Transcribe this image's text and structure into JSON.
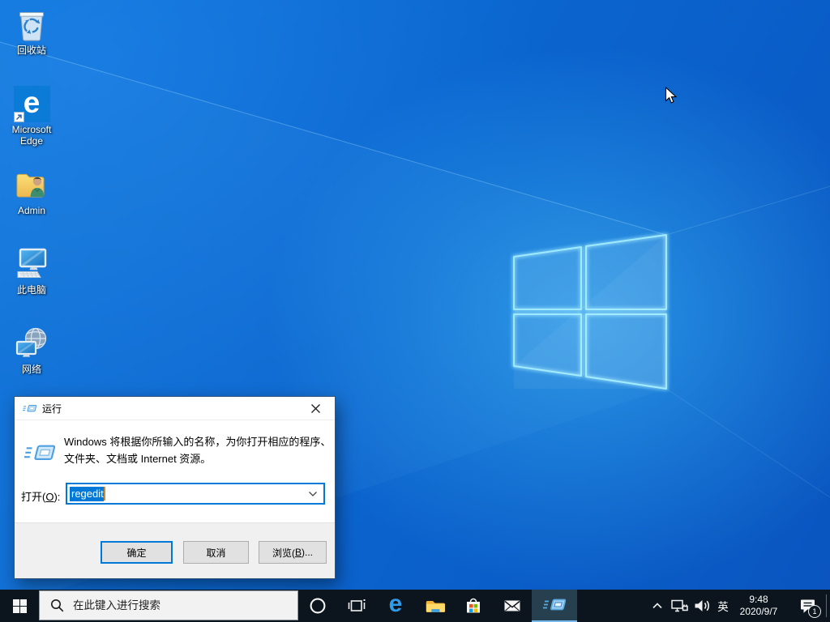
{
  "desktop": {
    "icons": [
      {
        "label": "回收站"
      },
      {
        "label": "Microsoft Edge"
      },
      {
        "label": "Admin"
      },
      {
        "label": "此电脑"
      },
      {
        "label": "网络"
      }
    ]
  },
  "run_dialog": {
    "title": "运行",
    "description_line1": "Windows 将根据你所输入的名称，为你打开相应的程序、",
    "description_line2": "文件夹、文档或 Internet 资源。",
    "open_label": {
      "prefix": "打开(",
      "access_key": "O",
      "suffix": "):"
    },
    "input_value": "regedit",
    "ok_button": "确定",
    "cancel_button": "取消",
    "browse_button": {
      "prefix": "浏览(",
      "access_key": "B",
      "suffix": ")..."
    }
  },
  "taskbar": {
    "search_placeholder": "在此键入进行搜索",
    "ime_indicator": "英",
    "clock": {
      "time": "9:48",
      "date": "2020/9/7"
    },
    "notification_badge": "1"
  },
  "icons": {
    "edge_glyph": "e"
  },
  "colors": {
    "accent": "#0078d7",
    "taskbar_background": "#0c151d",
    "selection": "#0078d7",
    "active_app_underline": "#76b9ed"
  }
}
